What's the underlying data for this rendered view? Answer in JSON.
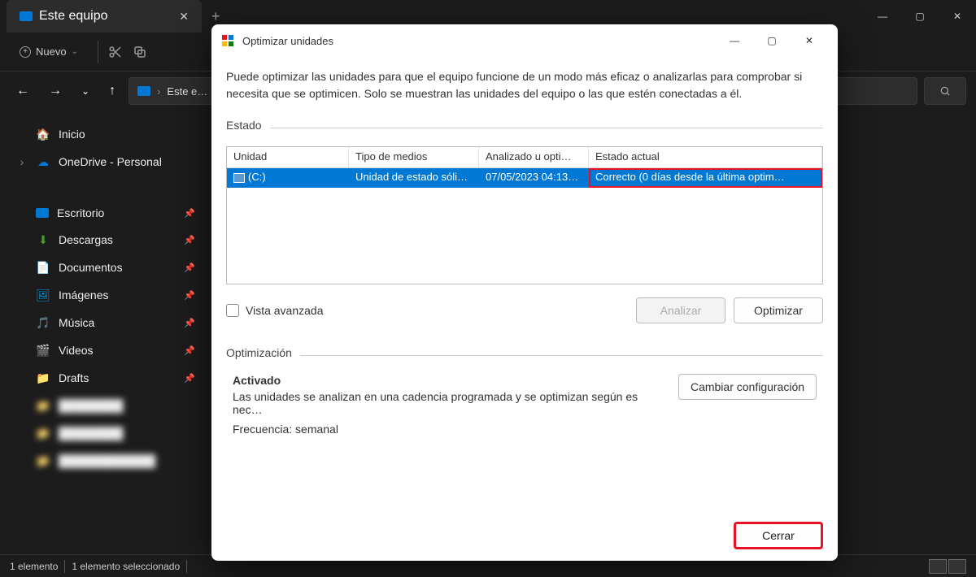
{
  "explorer": {
    "tab_title": "Este equipo",
    "nuevo_label": "Nuevo",
    "address": "Este e…",
    "sidebar": {
      "inicio": "Inicio",
      "onedrive": "OneDrive - Personal",
      "escritorio": "Escritorio",
      "descargas": "Descargas",
      "documentos": "Documentos",
      "imagenes": "Imágenes",
      "musica": "Música",
      "videos": "Videos",
      "drafts": "Drafts"
    },
    "status_items": "1 elemento",
    "status_selected": "1 elemento seleccionado"
  },
  "dialog": {
    "title": "Optimizar unidades",
    "description": "Puede optimizar las unidades para que el equipo funcione de un modo más eficaz o analizarlas para comprobar si necesita que se optimicen. Solo se muestran las unidades del equipo o las que estén conectadas a él.",
    "estado_label": "Estado",
    "columns": {
      "unidad": "Unidad",
      "tipo": "Tipo de medios",
      "analizado": "Analizado u opti…",
      "estado_actual": "Estado actual"
    },
    "row": {
      "unidad": "(C:)",
      "tipo": "Unidad de estado sóli…",
      "analizado": "07/05/2023 04:13…",
      "estado": "Correcto (0 días desde la última optim…"
    },
    "vista_avanzada": "Vista avanzada",
    "analizar_btn": "Analizar",
    "optimizar_btn": "Optimizar",
    "optimizacion_label": "Optimización",
    "activado": "Activado",
    "schedule_desc": "Las unidades se analizan en una cadencia programada y se optimizan según es nec…",
    "frecuencia": "Frecuencia: semanal",
    "cambiar_config": "Cambiar configuración",
    "cerrar": "Cerrar"
  }
}
